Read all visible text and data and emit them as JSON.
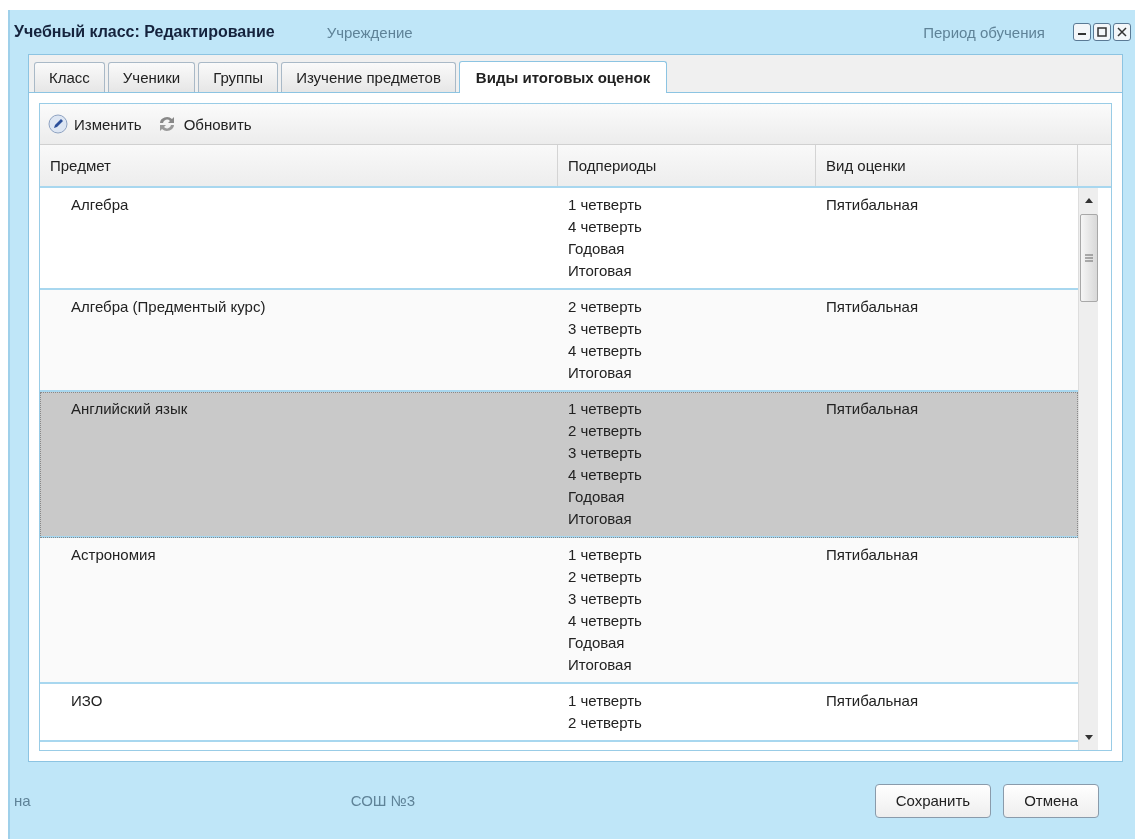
{
  "window": {
    "title": "Учебный класс: Редактирование"
  },
  "background_labels_top": [
    "Учреждение",
    "Период обучения"
  ],
  "background_labels_bottom": [
    "на",
    "СОШ №3"
  ],
  "tabs": [
    {
      "label": "Класс",
      "selected": false
    },
    {
      "label": "Ученики",
      "selected": false
    },
    {
      "label": "Группы",
      "selected": false
    },
    {
      "label": "Изучение предметов",
      "selected": false
    },
    {
      "label": "Виды итоговых оценок",
      "selected": true
    }
  ],
  "toolbar": [
    {
      "kind": "edit",
      "label": "Изменить"
    },
    {
      "kind": "refresh",
      "label": "Обновить"
    }
  ],
  "table": {
    "columns": [
      "Предмет",
      "Подпериоды",
      "Вид оценки"
    ],
    "rows": [
      {
        "subject": "Алгебра",
        "periods": [
          "1 четверть",
          "4 четверть",
          "Годовая",
          "Итоговая"
        ],
        "grade_type": "Пятибальная",
        "selected": false
      },
      {
        "subject": "Алгебра (Предментый курс)",
        "periods": [
          "2 четверть",
          "3 четверть",
          "4 четверть",
          "Итоговая"
        ],
        "grade_type": "Пятибальная",
        "selected": false
      },
      {
        "subject": "Английский язык",
        "periods": [
          "1 четверть",
          "2 четверть",
          "3 четверть",
          "4 четверть",
          "Годовая",
          "Итоговая"
        ],
        "grade_type": "Пятибальная",
        "selected": true
      },
      {
        "subject": "Астрономия",
        "periods": [
          "1 четверть",
          "2 четверть",
          "3 четверть",
          "4 четверть",
          "Годовая",
          "Итоговая"
        ],
        "grade_type": "Пятибальная",
        "selected": false
      },
      {
        "subject": "ИЗО",
        "periods": [
          "1 четверть",
          "2 четверть"
        ],
        "grade_type": "Пятибальная",
        "selected": false
      }
    ]
  },
  "buttons": [
    "Сохранить",
    "Отмена"
  ]
}
